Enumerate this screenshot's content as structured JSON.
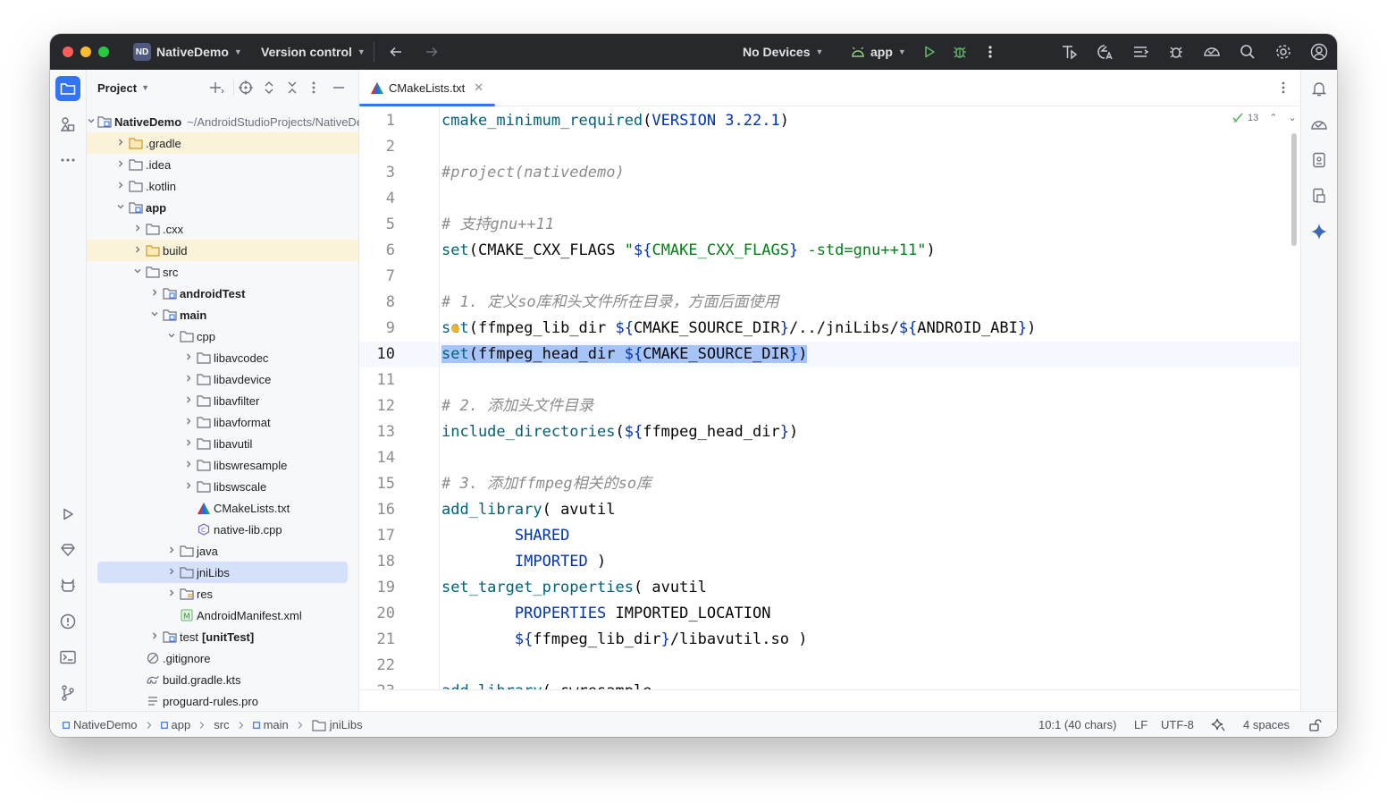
{
  "titlebar": {
    "project_badge": "ND",
    "project_name": "NativeDemo",
    "vcs": "Version control",
    "devices": "No Devices",
    "run_config": "app"
  },
  "panel": {
    "title": "Project"
  },
  "tree": [
    {
      "label": "NativeDemo",
      "suffix": "~/AndroidStudioProjects/NativeDemo",
      "depth": 0,
      "expanded": true,
      "icon": "module",
      "bold": true
    },
    {
      "label": ".gradle",
      "depth": 1,
      "expanded": false,
      "icon": "folder-yellow",
      "highlight": true
    },
    {
      "label": ".idea",
      "depth": 1,
      "expanded": false,
      "icon": "folder"
    },
    {
      "label": ".kotlin",
      "depth": 1,
      "expanded": false,
      "icon": "folder"
    },
    {
      "label": "app",
      "depth": 1,
      "expanded": true,
      "icon": "module",
      "bold": true
    },
    {
      "label": ".cxx",
      "depth": 2,
      "expanded": false,
      "icon": "folder"
    },
    {
      "label": "build",
      "depth": 2,
      "expanded": false,
      "icon": "folder-yellow",
      "highlight": true
    },
    {
      "label": "src",
      "depth": 2,
      "expanded": true,
      "icon": "folder"
    },
    {
      "label": "androidTest",
      "depth": 3,
      "expanded": false,
      "icon": "module",
      "bold": true
    },
    {
      "label": "main",
      "depth": 3,
      "expanded": true,
      "icon": "module",
      "bold": true
    },
    {
      "label": "cpp",
      "depth": 4,
      "expanded": true,
      "icon": "folder"
    },
    {
      "label": "libavcodec",
      "depth": 5,
      "expanded": false,
      "icon": "folder"
    },
    {
      "label": "libavdevice",
      "depth": 5,
      "expanded": false,
      "icon": "folder"
    },
    {
      "label": "libavfilter",
      "depth": 5,
      "expanded": false,
      "icon": "folder"
    },
    {
      "label": "libavformat",
      "depth": 5,
      "expanded": false,
      "icon": "folder"
    },
    {
      "label": "libavutil",
      "depth": 5,
      "expanded": false,
      "icon": "folder"
    },
    {
      "label": "libswresample",
      "depth": 5,
      "expanded": false,
      "icon": "folder"
    },
    {
      "label": "libswscale",
      "depth": 5,
      "expanded": false,
      "icon": "folder"
    },
    {
      "label": "CMakeLists.txt",
      "depth": 5,
      "leaf": true,
      "icon": "cmake"
    },
    {
      "label": "native-lib.cpp",
      "depth": 5,
      "leaf": true,
      "icon": "cpp"
    },
    {
      "label": "java",
      "depth": 4,
      "expanded": false,
      "icon": "folder"
    },
    {
      "label": "jniLibs",
      "depth": 4,
      "expanded": false,
      "icon": "folder",
      "selected": true
    },
    {
      "label": "res",
      "depth": 4,
      "expanded": false,
      "icon": "res"
    },
    {
      "label": "AndroidManifest.xml",
      "depth": 4,
      "leaf": true,
      "icon": "manifest"
    },
    {
      "label": "test",
      "suffix_bold": "[unitTest]",
      "depth": 3,
      "expanded": false,
      "icon": "module"
    },
    {
      "label": ".gitignore",
      "depth": 2,
      "leaf": true,
      "icon": "ignore"
    },
    {
      "label": "build.gradle.kts",
      "depth": 2,
      "leaf": true,
      "icon": "gradle"
    },
    {
      "label": "proguard-rules.pro",
      "depth": 2,
      "leaf": true,
      "icon": "text"
    }
  ],
  "editor": {
    "tab_label": "CMakeLists.txt",
    "inspection_count": "13",
    "current_line": 10,
    "lines": [
      [
        [
          "fn",
          "cmake_minimum_required"
        ],
        [
          "p",
          "("
        ],
        [
          "kw",
          "VERSION 3.22.1"
        ],
        [
          "p",
          ")"
        ]
      ],
      [],
      [
        [
          "cm",
          "#project(nativedemo)"
        ]
      ],
      [],
      [
        [
          "cm",
          "# 支持gnu++11"
        ]
      ],
      [
        [
          "fn",
          "set"
        ],
        [
          "p",
          "(CMAKE_CXX_FLAGS "
        ],
        [
          "st",
          "\""
        ],
        [
          "kw",
          "${"
        ],
        [
          "st",
          "CMAKE_CXX_FLAGS"
        ],
        [
          "kw",
          "}"
        ],
        [
          "st",
          " -std=gnu++11\""
        ],
        [
          "p",
          ")"
        ]
      ],
      [],
      [
        [
          "cm",
          "# 1. 定义so库和头文件所在目录，方面后面使用"
        ]
      ],
      [
        [
          "fn",
          "set"
        ],
        [
          "p",
          "(ffmpeg_lib_dir "
        ],
        [
          "kw",
          "${"
        ],
        [
          "p",
          "CMAKE_SOURCE_DIR"
        ],
        [
          "kw",
          "}"
        ],
        [
          "p",
          "/../jniLibs/"
        ],
        [
          "kw",
          "${"
        ],
        [
          "p",
          "ANDROID_ABI"
        ],
        [
          "kw",
          "}"
        ],
        [
          "p",
          ")"
        ]
      ],
      [
        [
          "fn",
          "set"
        ],
        [
          "p",
          "(ffmpeg_head_dir "
        ],
        [
          "kw",
          "${"
        ],
        [
          "p",
          "CMAKE_SOURCE_DIR"
        ],
        [
          "kw",
          "}"
        ],
        [
          "p",
          ")"
        ]
      ],
      [],
      [
        [
          "cm",
          "# 2. 添加头文件目录"
        ]
      ],
      [
        [
          "fn",
          "include_directories"
        ],
        [
          "p",
          "("
        ],
        [
          "kw",
          "${"
        ],
        [
          "p",
          "ffmpeg_head_dir"
        ],
        [
          "kw",
          "}"
        ],
        [
          "p",
          ")"
        ]
      ],
      [],
      [
        [
          "cm",
          "# 3. 添加ffmpeg相关的so库"
        ]
      ],
      [
        [
          "fn",
          "add_library"
        ],
        [
          "p",
          "( avutil"
        ]
      ],
      [
        [
          "p",
          "        "
        ],
        [
          "kw",
          "SHARED"
        ]
      ],
      [
        [
          "p",
          "        "
        ],
        [
          "kw",
          "IMPORTED"
        ],
        [
          "p",
          " )"
        ]
      ],
      [
        [
          "fn",
          "set_target_properties"
        ],
        [
          "p",
          "( avutil"
        ]
      ],
      [
        [
          "p",
          "        "
        ],
        [
          "kw",
          "PROPERTIES"
        ],
        [
          "p",
          " IMPORTED_LOCATION"
        ]
      ],
      [
        [
          "p",
          "        "
        ],
        [
          "kw",
          "${"
        ],
        [
          "p",
          "ffmpeg_lib_dir"
        ],
        [
          "kw",
          "}"
        ],
        [
          "p",
          "/libavutil.so )"
        ]
      ],
      [],
      [
        [
          "fn",
          "add_library"
        ],
        [
          "p",
          "( swresample"
        ]
      ]
    ]
  },
  "breadcrumb": [
    {
      "label": "NativeDemo",
      "icon": "module"
    },
    {
      "label": "app",
      "icon": "module"
    },
    {
      "label": "src",
      "icon": "none"
    },
    {
      "label": "main",
      "icon": "module"
    },
    {
      "label": "jniLibs",
      "icon": "folder"
    }
  ],
  "status": {
    "position": "10:1 (40 chars)",
    "line_sep": "LF",
    "encoding": "UTF-8",
    "indent": "4 spaces"
  },
  "colors": {
    "titlebar_bg": "#27282c",
    "selection": "#a6c4f7",
    "accent": "#3574f0",
    "highlight_folder": "#fbf3d9"
  }
}
